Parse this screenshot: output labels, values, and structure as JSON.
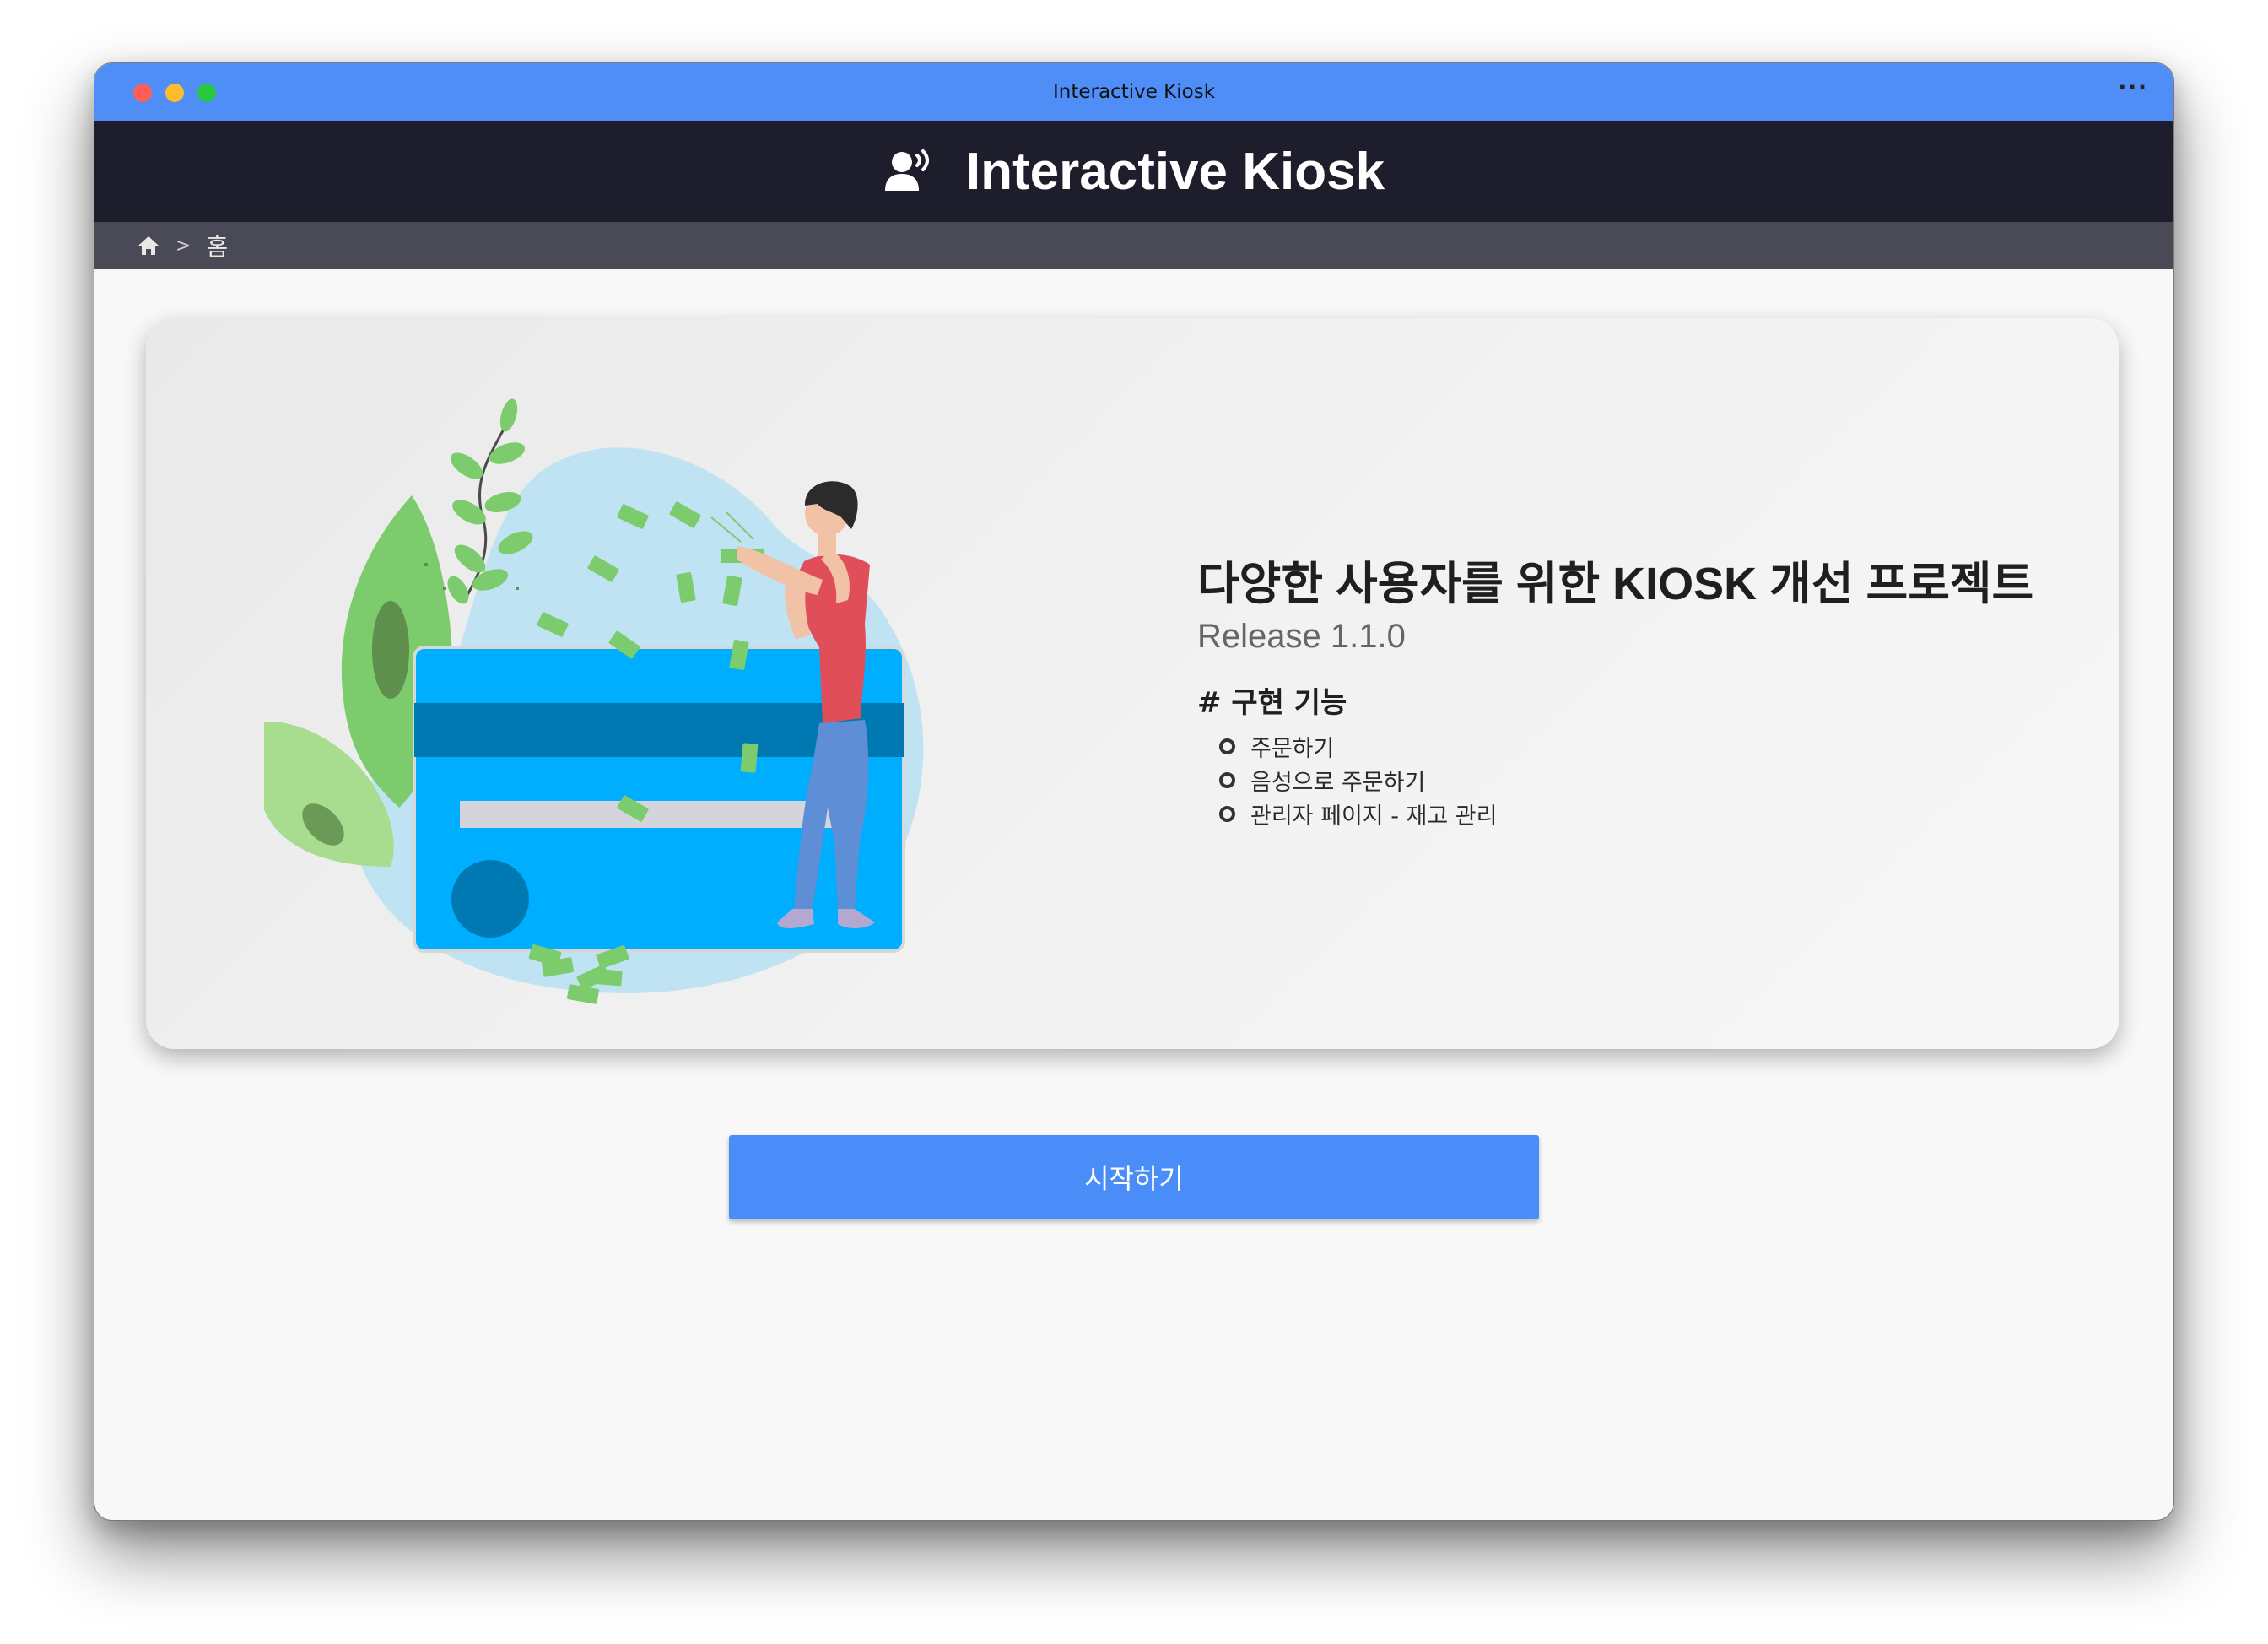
{
  "window": {
    "title": "Interactive Kiosk",
    "more_label": "···"
  },
  "header": {
    "icon": "person-speaking-icon",
    "title": "Interactive Kiosk"
  },
  "breadcrumb": {
    "home_icon": "home-icon",
    "separator": ">",
    "current": "홈"
  },
  "hero": {
    "illustration": "credit-card-person-money-illustration",
    "title": "다양한 사용자를 위한 KIOSK 개선 프로젝트",
    "release": "Release 1.1.0",
    "features_heading": "# 구현 기능",
    "features": [
      "주문하기",
      "음성으로 주문하기",
      "관리자 페이지 - 재고 관리"
    ]
  },
  "start_button": {
    "label": "시작하기"
  },
  "colors": {
    "titlebar": "#4f8ef7",
    "header": "#1d1d2c",
    "breadcrumb": "#4a4a56",
    "primary_button": "#4a8cf8",
    "card_blue": "#00aeff"
  }
}
